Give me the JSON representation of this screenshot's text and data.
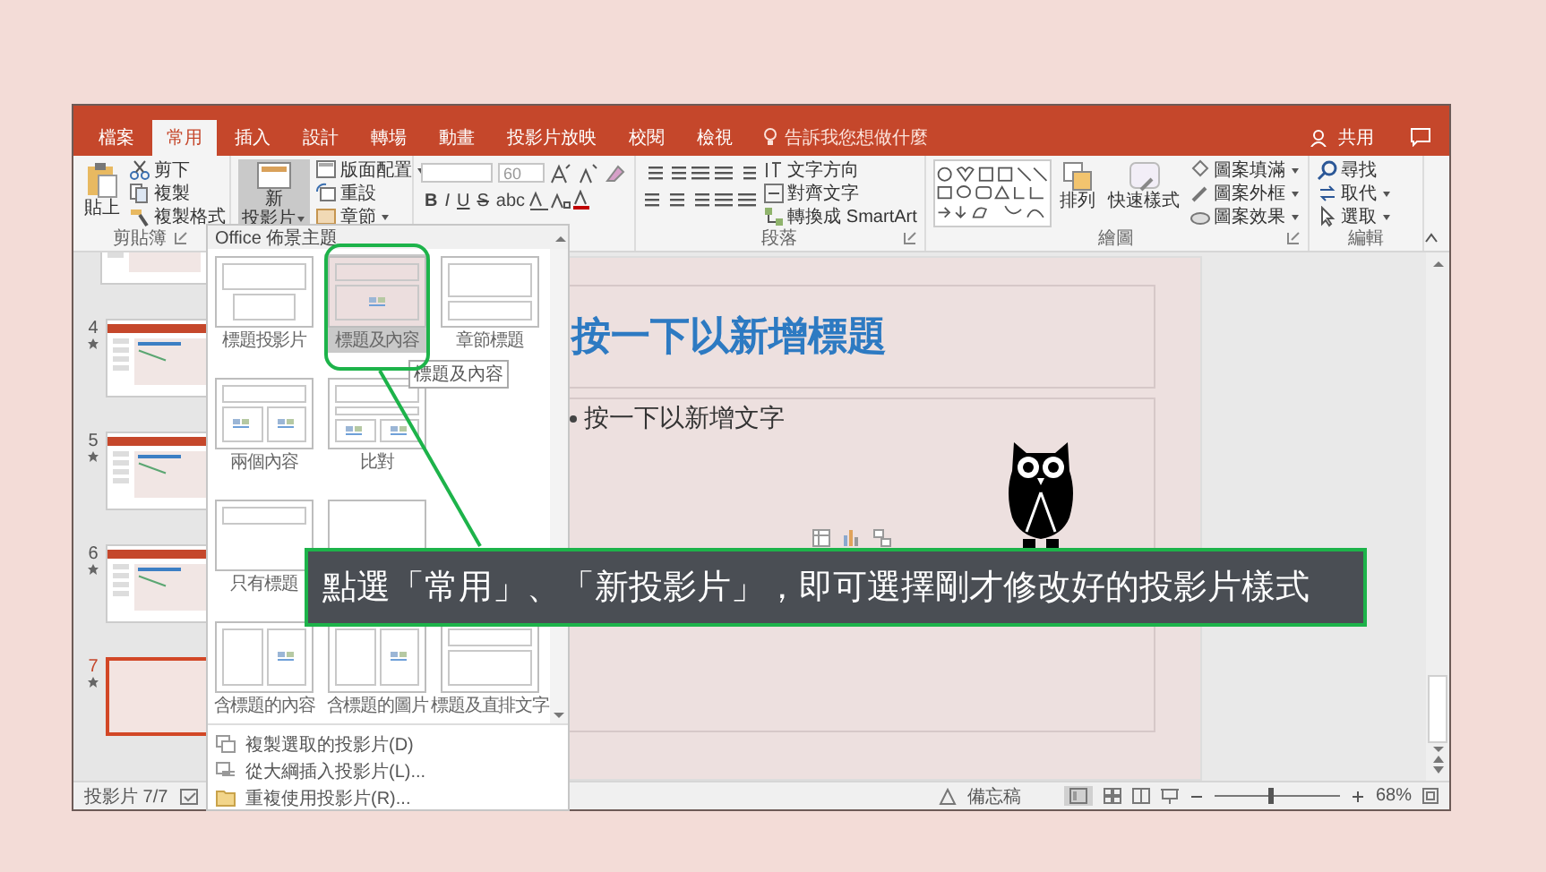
{
  "tabs": [
    {
      "label": "檔案",
      "selected": false
    },
    {
      "label": "常用",
      "selected": true
    },
    {
      "label": "插入",
      "selected": false
    },
    {
      "label": "設計",
      "selected": false
    },
    {
      "label": "轉場",
      "selected": false
    },
    {
      "label": "動畫",
      "selected": false
    },
    {
      "label": "投影片放映",
      "selected": false
    },
    {
      "label": "校閱",
      "selected": false
    },
    {
      "label": "檢視",
      "selected": false
    }
  ],
  "tell_me": "告訴我您想做什麼",
  "share": "共用",
  "ribbon": {
    "clipboard": {
      "paste": "貼上",
      "items": [
        "剪下",
        "複製",
        "複製格式"
      ],
      "label": "剪貼簿"
    },
    "slides": {
      "new_slide": [
        "新",
        "投影片"
      ],
      "pressed": true,
      "items": [
        "版面配置",
        "重設",
        "章節"
      ]
    },
    "font": {
      "size": "60",
      "buttons": [
        "B",
        "I",
        "U",
        "S",
        "abc"
      ]
    },
    "paragraph": {
      "items": [
        "文字方向",
        "對齊文字",
        "轉換成 SmartArt"
      ],
      "label": "段落"
    },
    "drawing": {
      "arrange": "排列",
      "quick_styles": "快速樣式",
      "items": [
        "圖案填滿",
        "圖案外框",
        "圖案效果"
      ],
      "label": "繪圖"
    },
    "editing": {
      "items": [
        "尋找",
        "取代",
        "選取"
      ],
      "label": "編輯"
    }
  },
  "thumbnails": [
    {
      "kind": "content",
      "selected": false
    },
    {
      "number": "4",
      "kind": "content",
      "selected": false
    },
    {
      "number": "5",
      "kind": "content",
      "selected": false
    },
    {
      "number": "6",
      "kind": "content",
      "selected": false
    },
    {
      "number": "7",
      "kind": "blank",
      "selected": true
    }
  ],
  "slide": {
    "title": "按一下以新增標題",
    "body": "按一下以新增文字"
  },
  "layout_menu": {
    "header": "Office 佈景主題",
    "rows": [
      [
        {
          "label": "標題投影片",
          "kind": "title",
          "selected": false
        },
        {
          "label": "標題及內容",
          "kind": "title_content",
          "selected": true
        },
        {
          "label": "章節標題",
          "kind": "section",
          "selected": false
        }
      ],
      [
        {
          "label": "兩個內容",
          "kind": "two_content",
          "selected": false
        },
        {
          "label": "比對",
          "kind": "comparison",
          "selected": false
        }
      ],
      [
        {
          "label": "只有標題",
          "kind": "title_only",
          "selected": false
        },
        {
          "kind": "blank",
          "selected": false
        }
      ],
      [
        {
          "label": "含標題的內容",
          "kind": "content_caption",
          "selected": false
        },
        {
          "label": "含標題的圖片",
          "kind": "picture_caption",
          "selected": false
        },
        {
          "label": "標題及直排文字",
          "kind": "vertical_text",
          "selected": false
        }
      ]
    ],
    "tooltip": "標題及內容",
    "commands": [
      "複製選取的投影片(D)",
      "從大綱插入投影片(L)...",
      "重複使用投影片(R)..."
    ]
  },
  "callout": "點選「常用」、「新投影片」，即可選擇剛才修改好的投影片樣式",
  "status_bar": {
    "slide_count": "投影片 7/7",
    "notes": "備忘稿",
    "zoom": {
      "level": 0.45,
      "reading": "68%"
    }
  }
}
